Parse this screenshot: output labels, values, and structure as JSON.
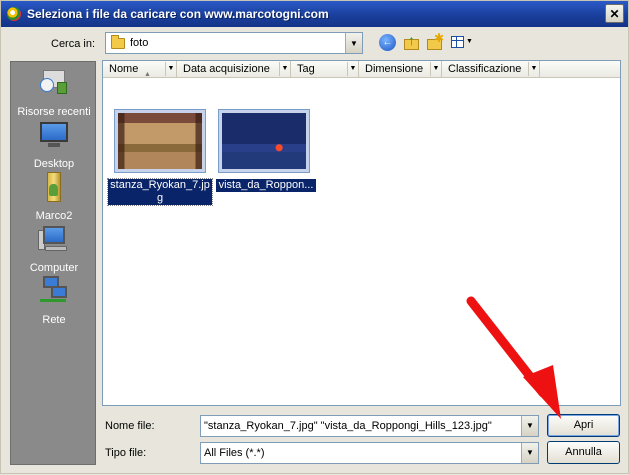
{
  "window": {
    "title": "Seleziona i file da caricare con www.marcotogni.com",
    "close_glyph": "✕"
  },
  "toolbar": {
    "lookin_label": "Cerca in:",
    "lookin_value": "foto"
  },
  "places": [
    {
      "label": "Risorse recenti",
      "icon": "recent-documents-icon"
    },
    {
      "label": "Desktop",
      "icon": "desktop-icon"
    },
    {
      "label": "Marco2",
      "icon": "user-folder-icon"
    },
    {
      "label": "Computer",
      "icon": "computer-icon"
    },
    {
      "label": "Rete",
      "icon": "network-icon"
    }
  ],
  "columns": [
    {
      "label": "Nome"
    },
    {
      "label": "Data acquisizione"
    },
    {
      "label": "Tag"
    },
    {
      "label": "Dimensione"
    },
    {
      "label": "Classificazione"
    }
  ],
  "files": [
    {
      "label_line1": "stanza_Ryokan_7.jp",
      "label_line2": "g"
    },
    {
      "label_line1": "vista_da_Roppon..."
    }
  ],
  "form": {
    "filename_label": "Nome file:",
    "filename_value": "\"stanza_Ryokan_7.jpg\" \"vista_da_Roppongi_Hills_123.jpg\"",
    "filetype_label": "Tipo file:",
    "filetype_value": "All Files (*.*)",
    "open_label": "Apri",
    "cancel_label": "Annulla"
  },
  "colors": {
    "annotation_arrow": "#ee1111",
    "selection": "#0a246a"
  }
}
